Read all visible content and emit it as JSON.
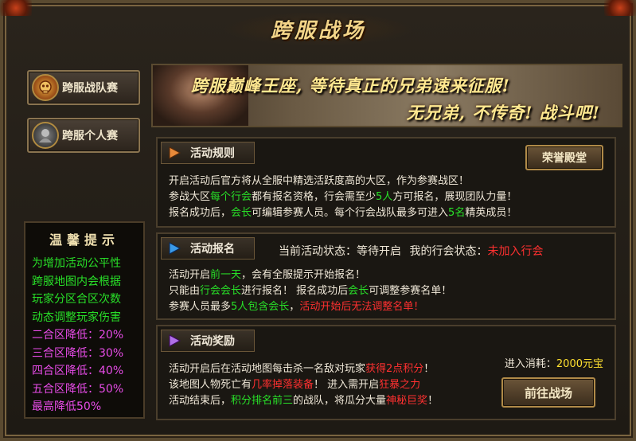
{
  "window": {
    "title": "跨服战场"
  },
  "nav": {
    "team_match": "跨服战队赛",
    "solo_match": "跨服个人赛"
  },
  "banner": {
    "line1": "跨服巅峰王座, 等待真正的兄弟速来征服!",
    "line2": "无兄弟, 不传奇! 战斗吧!"
  },
  "tips": {
    "title": "温馨提示",
    "lines": [
      "为增加活动公平性",
      "跨服地图内会根据",
      "玩家分区合区次数",
      "动态调整玩家伤害",
      "二合区降低：20%",
      "三合区降低：30%",
      "四合区降低：40%",
      "五合区降低：50%",
      "最高降低50%"
    ]
  },
  "rules": {
    "tab": "活动规则",
    "hall_button": "荣誉殿堂",
    "line1": "开启活动后官方将从全服中精选活跃度高的大区，作为参赛战区！",
    "line2_a": "参战大区",
    "line2_b": "每个行会",
    "line2_c": "都有报名资格，行会需至少",
    "line2_d": "5人",
    "line2_e": "方可报名，展现团队力量！",
    "line3_a": "报名成功后，",
    "line3_b": "会长",
    "line3_c": "可编辑参赛人员。每个行会战队最多可进入",
    "line3_d": "5名",
    "line3_e": "精英成员！"
  },
  "signup": {
    "tab": "活动报名",
    "status_label": "当前活动状态：等待开启",
    "guild_status_label": "我的行会状态：",
    "guild_status_value": "未加入行会",
    "line1_a": "活动开启",
    "line1_b": "前一天",
    "line1_c": "，会有全服提示开始报名！",
    "line2_a": "只能由",
    "line2_b": "行会会长",
    "line2_c": "进行报名！ 报名成功后",
    "line2_d": "会长",
    "line2_e": "可调整参赛名单！",
    "line3_a": "参赛人员最多",
    "line3_b": "5人包含会长",
    "line3_c": "，",
    "line3_d": "活动开始后无法调整名单！"
  },
  "rewards": {
    "tab": "活动奖励",
    "cost_label": "进入消耗：",
    "cost_value": "2000元宝",
    "enter_button": "前往战场",
    "line1_a": "活动开启后在活动地图每击杀一名敌对玩家",
    "line1_b": "获得2点积分",
    "line1_c": "！",
    "line2_a": "该地图人物死亡有",
    "line2_b": "几率掉落装备",
    "line2_c": "！ 进入需开启",
    "line2_d": "狂暴之力",
    "line3_a": "活动结束后，",
    "line3_b": "积分排名前三",
    "line3_c": "的战队，将瓜分大量",
    "line3_d": "神秘巨奖",
    "line3_e": "！"
  },
  "colors": {
    "green": "#28e028",
    "red": "#ff3030",
    "yellow": "#ffe030",
    "magenta": "#e84ce8",
    "gold": "#f3d488"
  }
}
